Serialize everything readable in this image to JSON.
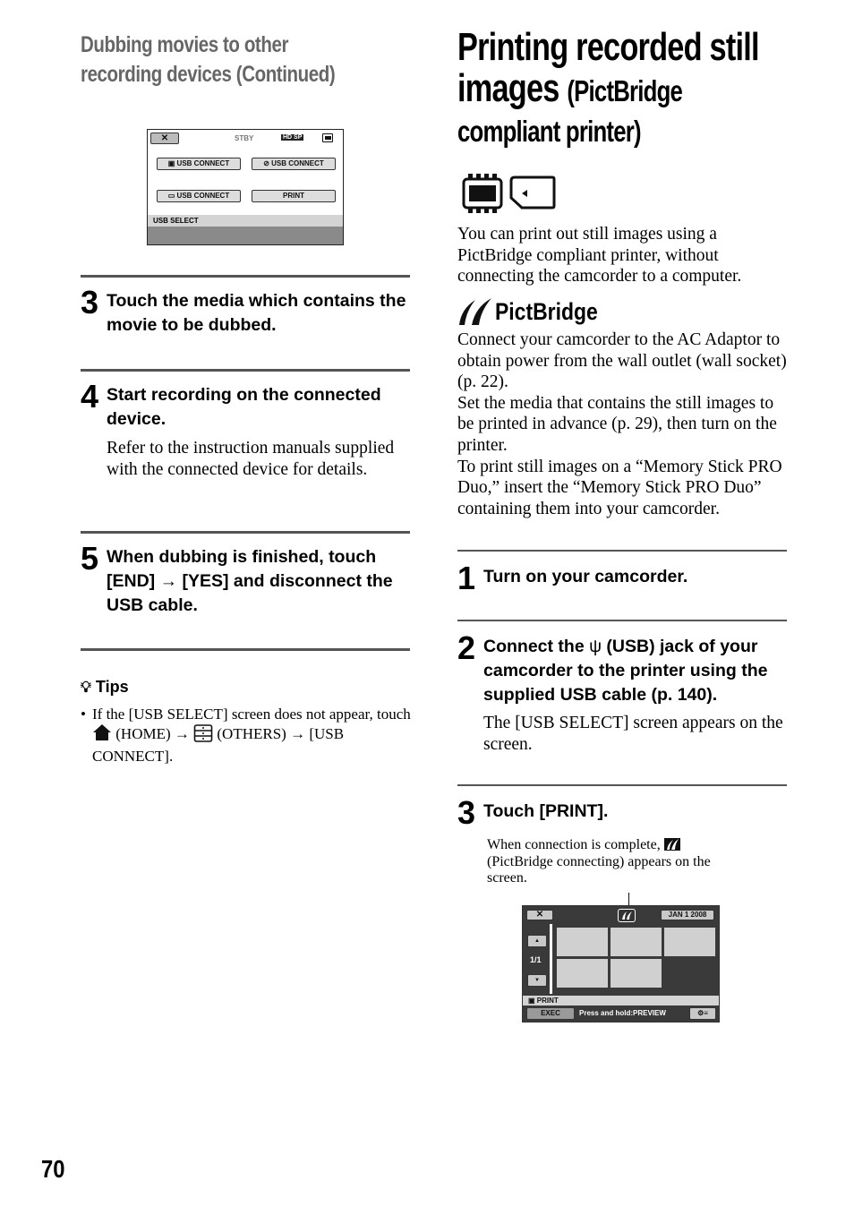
{
  "left": {
    "section_title_line1": "Dubbing movies to other",
    "section_title_line2": "recording devices (Continued)",
    "usb_screen": {
      "close_label": "✕",
      "status": "STBY",
      "quality": "HD SP",
      "media_icon": "internal-memory-icon",
      "buttons": [
        {
          "icon": "internal-memory-icon",
          "label": "USB CONNECT"
        },
        {
          "icon": "disc-icon",
          "label": "USB CONNECT"
        },
        {
          "icon": "memory-stick-icon",
          "label": "USB CONNECT"
        },
        {
          "icon": "",
          "label": "PRINT"
        }
      ],
      "footer": "USB SELECT"
    },
    "steps": [
      {
        "num": "3",
        "title": "Touch the media which contains the movie to be dubbed.",
        "body": ""
      },
      {
        "num": "4",
        "title": "Start recording on the connected device.",
        "body": "Refer to the instruction manuals supplied with the connected device for details."
      },
      {
        "num": "5",
        "title": "When dubbing is finished, touch [END] → [YES] and disconnect the USB cable.",
        "body": ""
      }
    ],
    "tips": {
      "heading": "Tips",
      "bullet_part1": "If the [USB SELECT] screen does not appear, touch",
      "home_label": "(HOME) →",
      "others_label": "(OTHERS) → [USB",
      "bullet_end": "CONNECT]."
    }
  },
  "right": {
    "title_main_line1": "Printing recorded still",
    "title_main_line2": "images",
    "title_sub_line2": "(PictBridge",
    "title_sub_line3": "compliant printer)",
    "media_icons": [
      "internal-memory-icon",
      "memory-stick-icon"
    ],
    "intro": "You can print out still images using a PictBridge compliant printer, without connecting the camcorder to a computer.",
    "pictbridge_logo": "PictBridge",
    "paragraphs": [
      "Connect your camcorder to the AC Adaptor to obtain power from the wall outlet (wall socket) (p. 22).",
      "Set the media that contains the still images to be printed in advance (p. 29), then turn on the printer.",
      "To print still images on a “Memory Stick PRO Duo,” insert the “Memory Stick PRO Duo” containing them into your camcorder."
    ],
    "steps": [
      {
        "num": "1",
        "title": "Turn on your camcorder.",
        "body": ""
      },
      {
        "num": "2",
        "title_a": "Connect the",
        "title_b": "(USB) jack of your camcorder to the printer using the supplied USB cable (p. 140).",
        "body": "The [USB SELECT] screen appears on the screen."
      },
      {
        "num": "3",
        "title": "Touch [PRINT].",
        "body": ""
      }
    ],
    "note_a": "When connection is complete,",
    "note_b": "(PictBridge connecting) appears on the screen.",
    "print_screen": {
      "close_label": "✕",
      "date": "JAN  1  2008",
      "page": "1/1",
      "thumb_count": 5,
      "footer_label": "PRINT",
      "exec_label": "EXEC",
      "hint": "Press and hold:PREVIEW"
    }
  },
  "page_number": "70"
}
